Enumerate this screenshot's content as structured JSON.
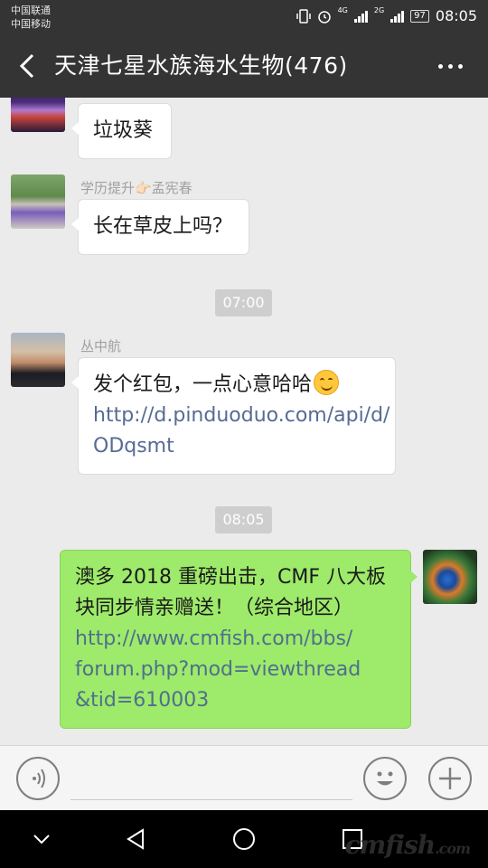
{
  "status_bar": {
    "carrier_1": "中国联通",
    "carrier_2": "中国移动",
    "network_1": "4G",
    "network_2": "2G",
    "battery": "97",
    "time": "08:05"
  },
  "header": {
    "title": "天津七星水族海水生物(476)"
  },
  "messages": [
    {
      "type": "incoming",
      "text": "垃圾葵"
    },
    {
      "type": "incoming",
      "sender": "学历提升👉🏻孟宪春",
      "text": "长在草皮上吗？"
    },
    {
      "type": "timestamp",
      "text": "07:00"
    },
    {
      "type": "incoming",
      "sender": "丛中航",
      "text": "发个红包，一点心意哈哈",
      "emoji": "smile-emoji",
      "link_lines": [
        "http://d.pinduoduo.com/api/d/",
        "ODqsmt"
      ]
    },
    {
      "type": "timestamp",
      "text": "08:05"
    },
    {
      "type": "outgoing",
      "text_lines": [
        "澳多 2018 重磅出击，CMF 八大板",
        "块同步情亲赠送！（综合地区）"
      ],
      "link_lines": [
        "http://www.cmfish.com/bbs/",
        "forum.php?mod=viewthread",
        "&tid=610003"
      ]
    }
  ],
  "input_bar": {
    "voice_icon": "voice-icon",
    "emoji_icon": "emoji-icon",
    "plus_icon": "plus-icon"
  },
  "nav_bar": {
    "icons": [
      "chevron-down-icon",
      "back-triangle-icon",
      "home-circle-icon",
      "recents-square-icon"
    ]
  },
  "watermark": {
    "text": "cmfish",
    "suffix": ".com"
  },
  "colors": {
    "header_bg": "#343434",
    "chat_bg": "#ebebeb",
    "outgoing_bubble": "#9eea6a",
    "link": "#576b95"
  }
}
